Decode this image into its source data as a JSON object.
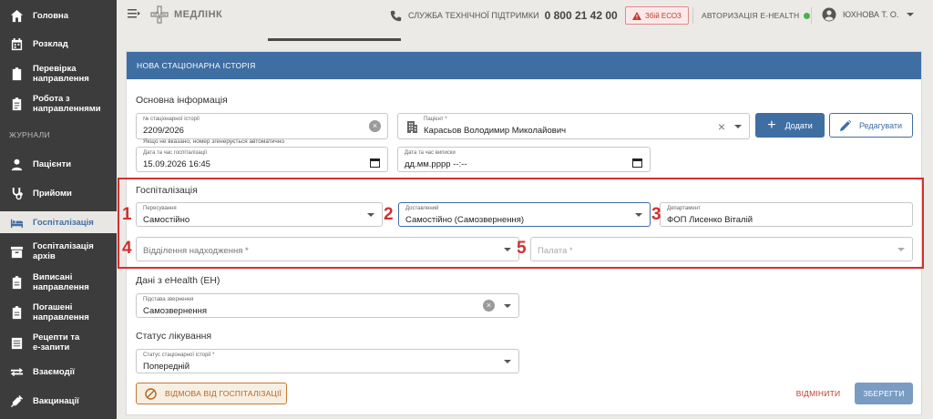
{
  "sidebar": {
    "items": [
      {
        "label": "Головна",
        "icon": "home-icon"
      },
      {
        "label": "Розклад",
        "icon": "calendar-icon"
      },
      {
        "label": "Перевірка направлення",
        "icon": "clipboard-check-icon"
      },
      {
        "label": "Робота з направленнями",
        "icon": "clipboard-list-icon"
      },
      {
        "label": "Пацієнти",
        "icon": "person-icon"
      },
      {
        "label": "Прийоми",
        "icon": "stethoscope-icon"
      },
      {
        "label": "Госпіталізація",
        "icon": "bed-icon"
      },
      {
        "label": "Госпіталізація архів",
        "icon": "archive-icon"
      },
      {
        "label": "Виписані направлення",
        "icon": "clipboard-icon"
      },
      {
        "label": "Погашені направлення",
        "icon": "clipboard-icon"
      },
      {
        "label": "Рецепти та е-запити",
        "icon": "list-icon"
      },
      {
        "label": "Взаємодії",
        "icon": "exchange-icon"
      },
      {
        "label": "Вакцинації",
        "icon": "syringe-icon"
      }
    ],
    "section_label": "ЖУРНАЛИ",
    "active_item": "Госпіталізація"
  },
  "topbar": {
    "logo_text": "МЕДЛІНК",
    "support_label": "СЛУЖБА ТЕХНІЧНОЇ ПІДТРИМКИ",
    "support_phone": "0 800 21 42 00",
    "alert_badge": "Збій ЕСОЗ",
    "auth_label": "АВТОРИЗАЦІЯ E-HEALTH",
    "auth_status_color": "#4caf50",
    "user_name": "ЮХНОВА Т. О."
  },
  "panel": {
    "title": "НОВА СТАЦІОНАРНА ІСТОРІЯ",
    "basic_info": {
      "title": "Основна інформація",
      "history_number": {
        "label": "№ стаціонарної історії",
        "value": "2209/2026",
        "helper": "Якщо не вказано, номер згенерується автоматично"
      },
      "patient": {
        "label": "Пацієнт *",
        "value": "Карасьов Володимир Миколайович"
      },
      "add_button": "Додати",
      "edit_button": "Редагувати",
      "hosp_datetime": {
        "label": "Дата та час госпіталізації",
        "value": "15.09.2026 16:45"
      },
      "discharge_datetime": {
        "label": "Дата та час виписки",
        "value": "дд.мм.рррр --:--"
      }
    },
    "hospitalization": {
      "title": "Госпіталізація",
      "transport": {
        "label": "Пересування",
        "value": "Самостійно"
      },
      "delivered": {
        "label": "Доставлений",
        "value": "Самостійно (Самозвернення)"
      },
      "department": {
        "label": "Департамент",
        "value": "ФОП Лисенко Віталій"
      },
      "admission_dept": {
        "placeholder": "Відділення надходження *"
      },
      "ward": {
        "placeholder": "Палата *"
      },
      "markers": [
        "1",
        "2",
        "3",
        "4",
        "5"
      ]
    },
    "ehealth": {
      "title": "Дані з eHealth (ЕН)",
      "basis": {
        "label": "Підстава звернення",
        "value": "Самозвернення"
      }
    },
    "treatment_status": {
      "title": "Статус лікування",
      "status": {
        "label": "Статус стаціонарної історії *",
        "value": "Попередній"
      }
    },
    "footer": {
      "refuse_button": "ВІДМОВА ВІД ГОСПІТАЛІЗАЦІЇ",
      "cancel_button": "ВІДМІНИТИ",
      "save_button": "ЗБЕРЕГТИ"
    }
  },
  "colors": {
    "accent": "#3f6ea3",
    "sidebar_bg": "#3c3c3c",
    "highlight": "#d32f2f"
  }
}
